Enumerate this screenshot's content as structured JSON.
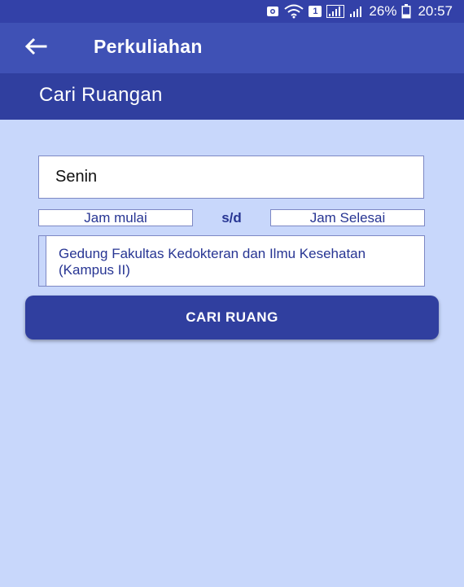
{
  "status_bar": {
    "battery_percent": "26%",
    "time": "20:57",
    "sim_badge": "1"
  },
  "app_bar": {
    "title": "Perkuliahan",
    "back_icon": "arrow-left-icon"
  },
  "section": {
    "title": "Cari Ruangan"
  },
  "form": {
    "day_value": "Senin",
    "time_start_placeholder": "Jam mulai",
    "separator": "s/d",
    "time_end_placeholder": "Jam Selesai",
    "building_value": "Gedung Fakultas Kedokteran dan Ilmu Kesehatan (Kampus II)",
    "submit_label": "CARI RUANG"
  },
  "colors": {
    "background": "#c8d7fb",
    "app_bar": "#3f51b5",
    "status_bar": "#3341a8",
    "section_header": "#303f9f",
    "button": "#303f9f",
    "field_text": "#273593"
  }
}
